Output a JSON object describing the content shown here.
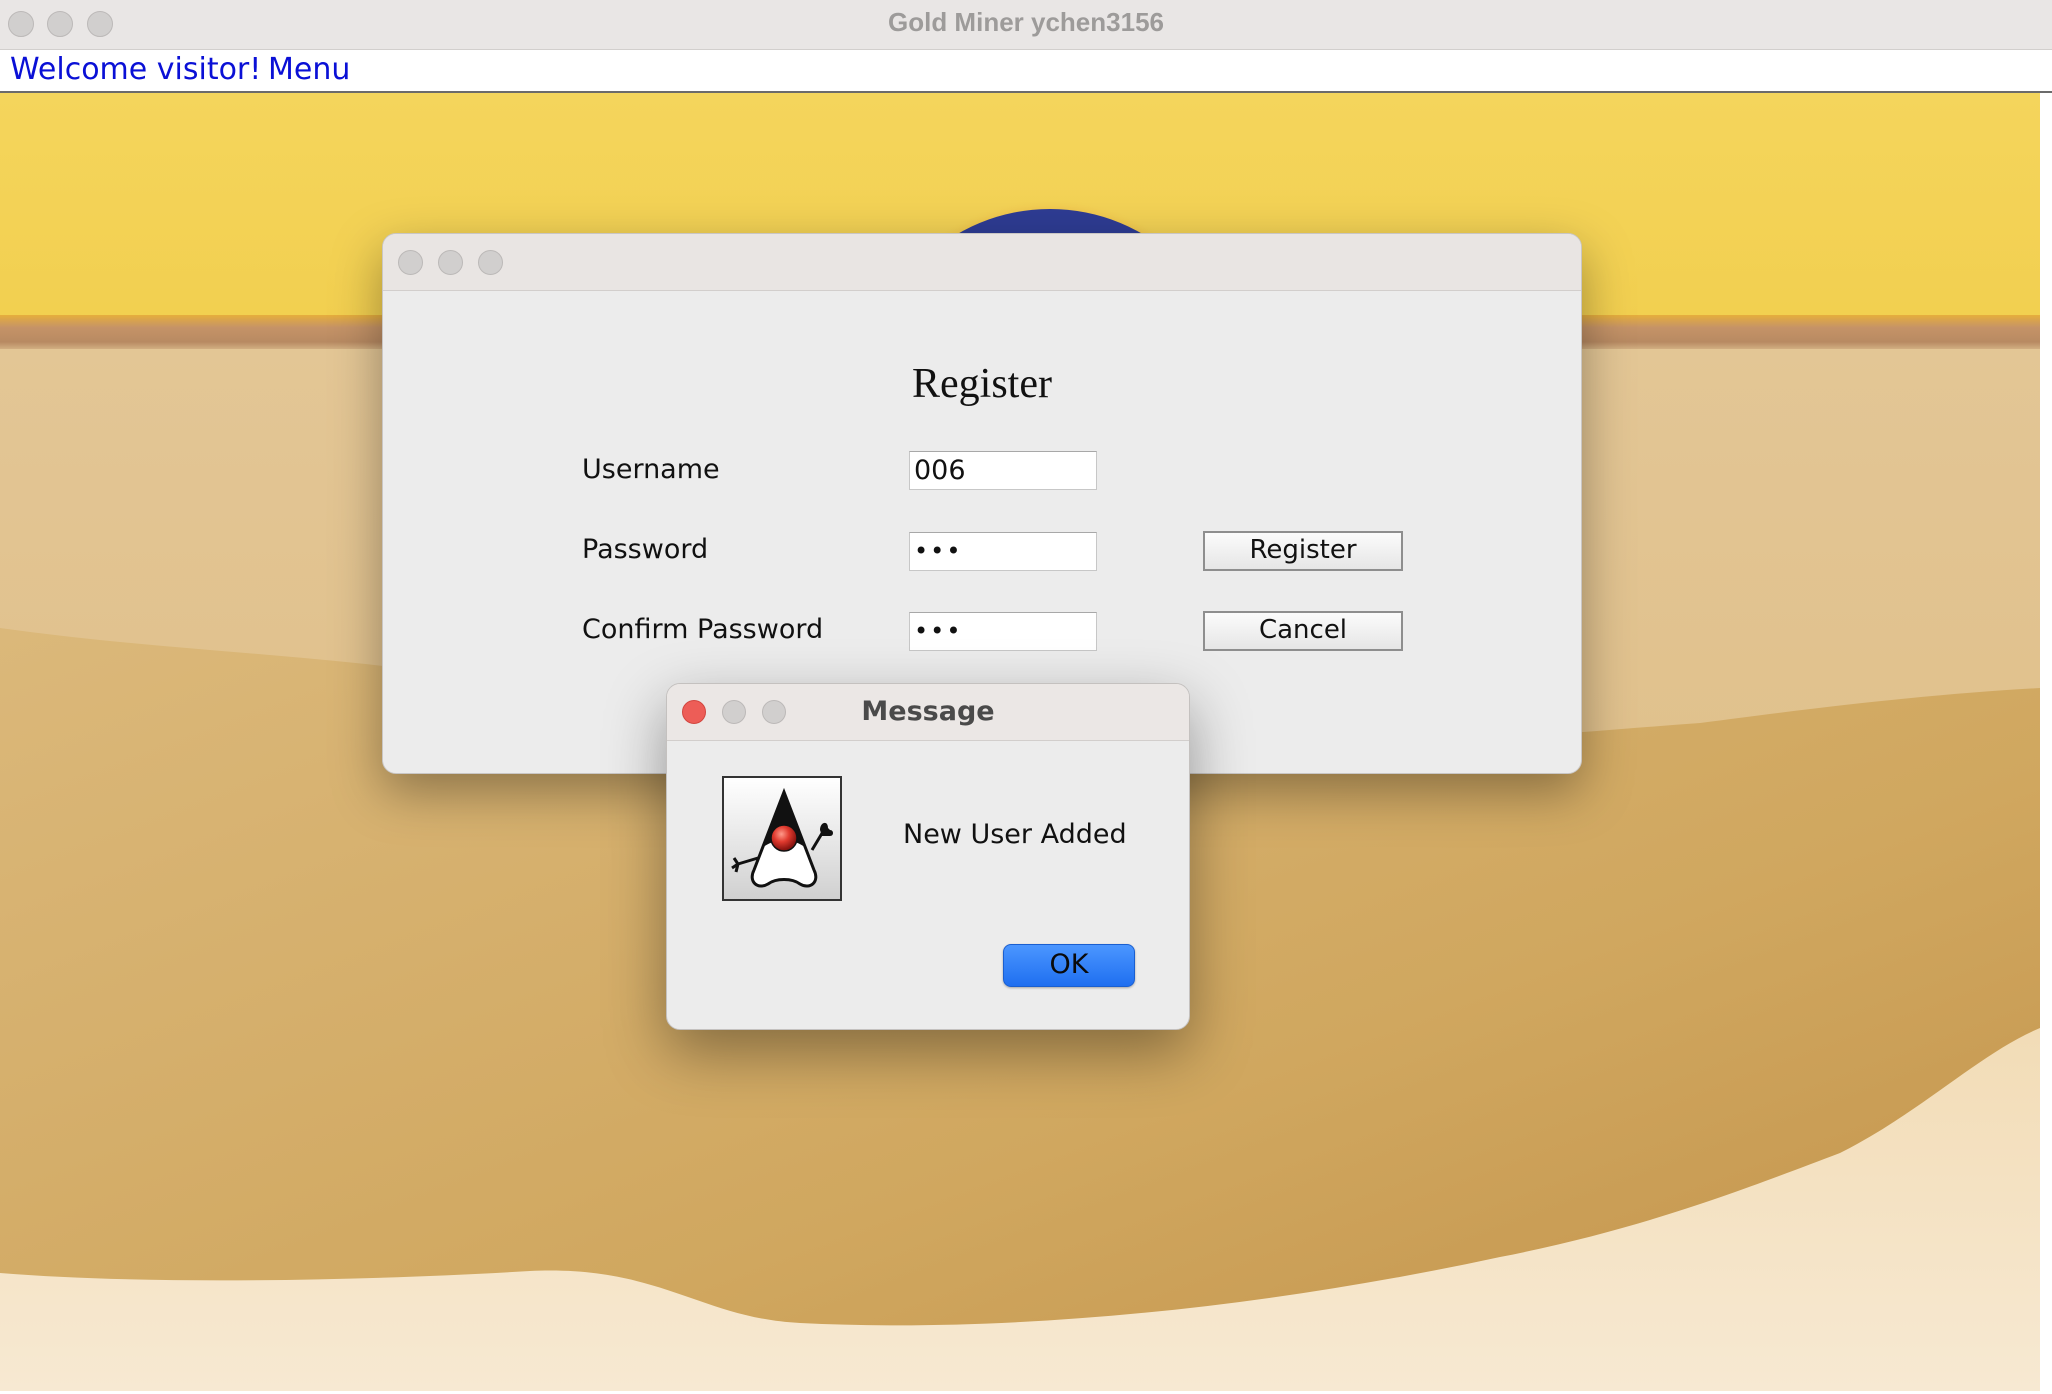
{
  "window": {
    "title": "Gold Miner ychen3156"
  },
  "menubar": {
    "welcome": "Welcome visitor!",
    "menu": "Menu"
  },
  "register_dialog": {
    "title": "Register",
    "username_label": "Username",
    "username_value": "006",
    "password_label": "Password",
    "password_value": "•••",
    "confirm_label": "Confirm Password",
    "confirm_value": "•••",
    "register_button": "Register",
    "cancel_button": "Cancel"
  },
  "message_dialog": {
    "title": "Message",
    "text": "New User Added",
    "ok_button": "OK",
    "icon": "java-duke-icon"
  },
  "colors": {
    "sky": "#f3d45a",
    "sun": "#2e3c93",
    "sand": "#d2ab66",
    "link": "#0a10d6",
    "ok_button": "#2a7cf6",
    "close_red": "#ed5d57"
  }
}
